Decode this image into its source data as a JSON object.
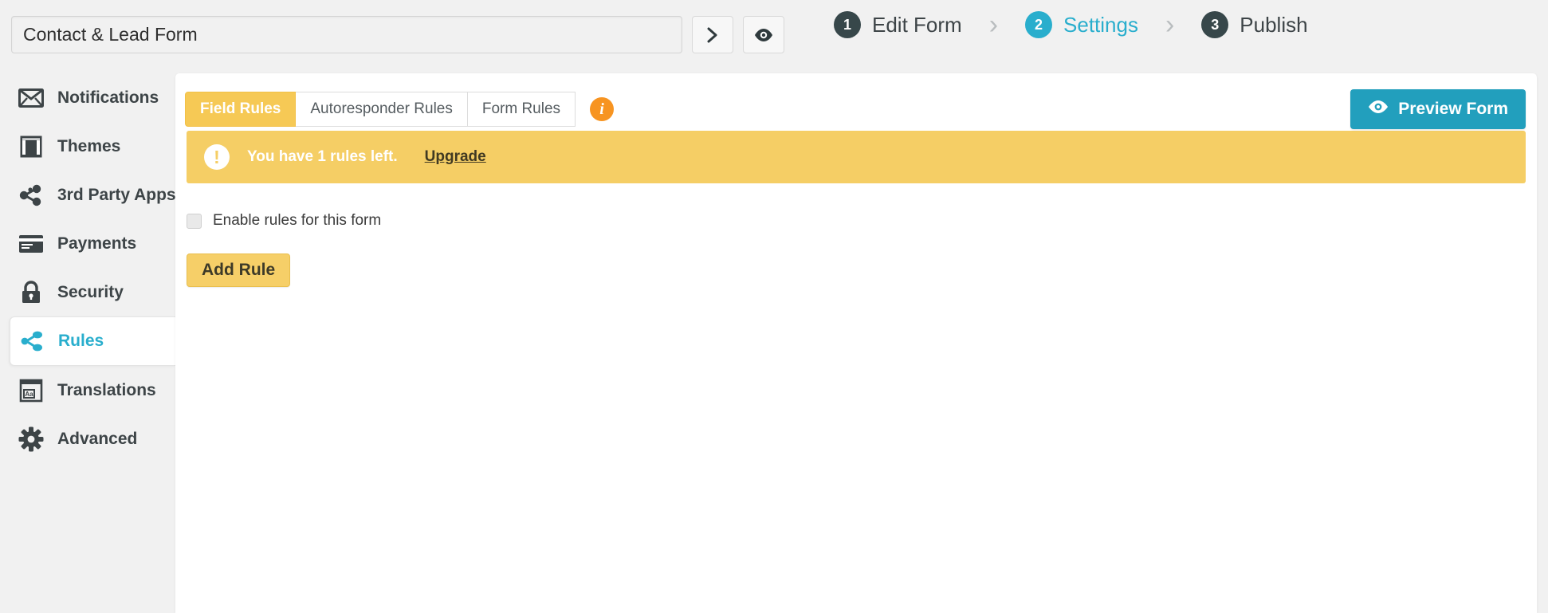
{
  "topbar": {
    "form_title_value": "Contact & Lead Form",
    "form_title_placeholder": "Form Title",
    "next_button_icon": "chevron-right-icon",
    "preview_eye_icon": "eye-icon",
    "steps": [
      {
        "number": "1",
        "label": "Edit Form",
        "state": "inactive"
      },
      {
        "number": "2",
        "label": "Settings",
        "state": "active"
      },
      {
        "number": "3",
        "label": "Publish",
        "state": "inactive"
      }
    ],
    "step_separator": "›"
  },
  "sidebar": {
    "items": [
      {
        "label": "Notifications",
        "icon": "envelope-icon",
        "active": false
      },
      {
        "label": "Themes",
        "icon": "layout-icon",
        "active": false
      },
      {
        "label": "3rd Party Apps",
        "icon": "share-nodes-icon",
        "active": false
      },
      {
        "label": "Payments",
        "icon": "credit-card-icon",
        "active": false
      },
      {
        "label": "Security",
        "icon": "lock-icon",
        "active": false
      },
      {
        "label": "Rules",
        "icon": "sitemap-icon",
        "active": true
      },
      {
        "label": "Translations",
        "icon": "translate-aa-icon",
        "active": false
      },
      {
        "label": "Advanced",
        "icon": "gear-icon",
        "active": false
      }
    ]
  },
  "main": {
    "tabs": [
      {
        "label": "Field Rules",
        "active": true
      },
      {
        "label": "Autoresponder Rules",
        "active": false
      },
      {
        "label": "Form Rules",
        "active": false
      }
    ],
    "info_badge": "i",
    "preview_button": {
      "label": "Preview Form",
      "icon": "eye-icon"
    },
    "notice": {
      "icon": "exclamation-icon",
      "glyph": "!",
      "text": "You have 1 rules left.",
      "link_label": "Upgrade"
    },
    "enable_rules": {
      "label": "Enable rules for this form",
      "checked": false
    },
    "add_rule_label": "Add Rule"
  },
  "colors": {
    "page_background": "#f1f1f1",
    "panel_background": "#ffffff",
    "accent_teal": "#229fbd",
    "accent_yellow": "#f6c955",
    "notice_yellow": "#f5ce65",
    "info_orange": "#f79421",
    "dark_slate": "#37474a"
  }
}
